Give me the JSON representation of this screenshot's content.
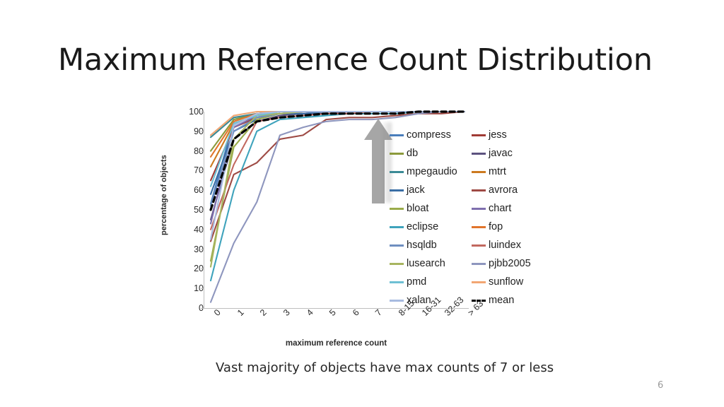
{
  "slide": {
    "title": "Maximum Reference Count Distribution",
    "caption": "Vast majority of objects have max counts of 7 or less",
    "number": "6"
  },
  "chart_data": {
    "type": "line",
    "title": "",
    "xlabel": "maximum reference count",
    "ylabel": "percentage of objects",
    "categories": [
      "0",
      "1",
      "2",
      "3",
      "4",
      "5",
      "6",
      "7",
      "8-15",
      "16-31",
      "32-63",
      "> 63"
    ],
    "ylim": [
      0,
      100
    ],
    "yticks": [
      0,
      10,
      20,
      30,
      40,
      50,
      60,
      70,
      80,
      90,
      100
    ],
    "grid": false,
    "legend_position": "right",
    "series": [
      {
        "name": "compress",
        "color": "#4a7ebb",
        "values": [
          53,
          95,
          99,
          100,
          100,
          100,
          100,
          100,
          100,
          100,
          100,
          100
        ]
      },
      {
        "name": "jess",
        "color": "#a03a35",
        "values": [
          65,
          92,
          97,
          99,
          99,
          100,
          100,
          100,
          100,
          100,
          100,
          100
        ]
      },
      {
        "name": "db",
        "color": "#8c9a3c",
        "values": [
          80,
          96,
          99,
          100,
          100,
          100,
          100,
          100,
          100,
          100,
          100,
          100
        ]
      },
      {
        "name": "javac",
        "color": "#5c527f",
        "values": [
          45,
          86,
          95,
          98,
          99,
          99,
          100,
          100,
          100,
          100,
          100,
          100
        ]
      },
      {
        "name": "mpegaudio",
        "color": "#3b8a95",
        "values": [
          87,
          97,
          99,
          100,
          100,
          100,
          100,
          100,
          100,
          100,
          100,
          100
        ]
      },
      {
        "name": "mtrt",
        "color": "#cc7a1f",
        "values": [
          72,
          94,
          98,
          100,
          100,
          100,
          100,
          100,
          100,
          100,
          100,
          100
        ]
      },
      {
        "name": "jack",
        "color": "#3a6ea5",
        "values": [
          58,
          90,
          96,
          99,
          99,
          100,
          100,
          100,
          100,
          100,
          100,
          100
        ]
      },
      {
        "name": "avrora",
        "color": "#9e4a44",
        "values": [
          34,
          68,
          74,
          86,
          88,
          96,
          97,
          97,
          98,
          99,
          99,
          100
        ]
      },
      {
        "name": "bloat",
        "color": "#9aab4a",
        "values": [
          24,
          82,
          96,
          99,
          100,
          100,
          100,
          100,
          100,
          100,
          100,
          100
        ]
      },
      {
        "name": "chart",
        "color": "#7f6fae",
        "values": [
          43,
          92,
          98,
          99,
          100,
          100,
          100,
          100,
          100,
          100,
          100,
          100
        ]
      },
      {
        "name": "eclipse",
        "color": "#3fa3bc",
        "values": [
          14,
          60,
          90,
          96,
          97,
          98,
          99,
          99,
          99,
          100,
          100,
          100
        ]
      },
      {
        "name": "fop",
        "color": "#e1752c",
        "values": [
          77,
          95,
          99,
          100,
          100,
          100,
          100,
          100,
          100,
          100,
          100,
          100
        ]
      },
      {
        "name": "hsqldb",
        "color": "#6f8fc0",
        "values": [
          52,
          90,
          97,
          99,
          100,
          100,
          100,
          100,
          100,
          100,
          100,
          100
        ]
      },
      {
        "name": "luindex",
        "color": "#c2685f",
        "values": [
          40,
          73,
          95,
          97,
          98,
          99,
          99,
          100,
          100,
          100,
          100,
          100
        ]
      },
      {
        "name": "lusearch",
        "color": "#a8b560",
        "values": [
          21,
          86,
          98,
          99,
          100,
          100,
          100,
          100,
          100,
          100,
          100,
          100
        ]
      },
      {
        "name": "pjbb2005",
        "color": "#8e96be",
        "values": [
          3,
          33,
          54,
          88,
          92,
          95,
          96,
          96,
          97,
          99,
          100,
          100
        ]
      },
      {
        "name": "pmd",
        "color": "#6ec0d4",
        "values": [
          62,
          94,
          98,
          100,
          100,
          100,
          100,
          100,
          100,
          100,
          100,
          100
        ]
      },
      {
        "name": "sunflow",
        "color": "#f2a673",
        "values": [
          88,
          98,
          100,
          100,
          100,
          100,
          100,
          100,
          100,
          100,
          100,
          100
        ]
      },
      {
        "name": "xalan",
        "color": "#a8bbe0",
        "values": [
          35,
          93,
          99,
          100,
          100,
          100,
          100,
          100,
          100,
          100,
          100,
          100
        ]
      },
      {
        "name": "mean",
        "color": "#000000",
        "dashed": true,
        "values": [
          50,
          86,
          95,
          97,
          98,
          99,
          99,
          99,
          99,
          100,
          100,
          100
        ]
      }
    ]
  },
  "legend": {
    "columns": [
      [
        {
          "label": "compress",
          "color": "#4a7ebb"
        },
        {
          "label": "db",
          "color": "#8c9a3c"
        },
        {
          "label": "mpegaudio",
          "color": "#3b8a95"
        },
        {
          "label": "jack",
          "color": "#3a6ea5"
        },
        {
          "label": "bloat",
          "color": "#9aab4a"
        },
        {
          "label": "eclipse",
          "color": "#3fa3bc"
        },
        {
          "label": "hsqldb",
          "color": "#6f8fc0"
        },
        {
          "label": "lusearch",
          "color": "#a8b560"
        },
        {
          "label": "pmd",
          "color": "#6ec0d4"
        },
        {
          "label": "xalan",
          "color": "#a8bbe0"
        }
      ],
      [
        {
          "label": "jess",
          "color": "#a03a35"
        },
        {
          "label": "javac",
          "color": "#5c527f"
        },
        {
          "label": "mtrt",
          "color": "#cc7a1f"
        },
        {
          "label": "avrora",
          "color": "#9e4a44"
        },
        {
          "label": "chart",
          "color": "#7f6fae"
        },
        {
          "label": "fop",
          "color": "#e1752c"
        },
        {
          "label": "luindex",
          "color": "#c2685f"
        },
        {
          "label": "pjbb2005",
          "color": "#8e96be"
        },
        {
          "label": "sunflow",
          "color": "#f2a673"
        },
        {
          "label": "mean",
          "color": "#000000",
          "dashed": true
        }
      ]
    ]
  },
  "annotations": {
    "arrow": {
      "name": "up-arrow",
      "color": "#a6a6a6"
    }
  }
}
